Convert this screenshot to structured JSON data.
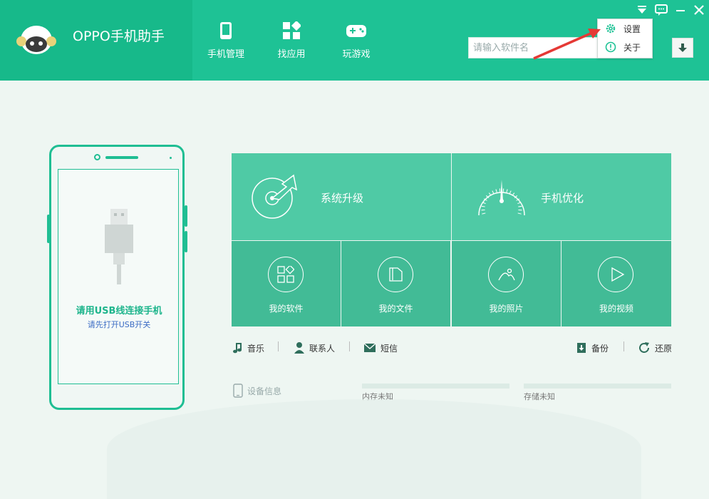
{
  "app": {
    "title": "OPPO手机助手"
  },
  "nav": [
    {
      "label": "手机管理",
      "icon": "phone-manage-icon"
    },
    {
      "label": "找应用",
      "icon": "apps-grid-icon"
    },
    {
      "label": "玩游戏",
      "icon": "gamepad-icon"
    }
  ],
  "search": {
    "placeholder": "请输入软件名"
  },
  "menu": {
    "items": [
      {
        "label": "设置",
        "icon": "gear-icon"
      },
      {
        "label": "关于",
        "icon": "info-icon"
      }
    ]
  },
  "connect": {
    "title": "请用USB线连接手机",
    "subtitle": "请先打开USB开关"
  },
  "tiles": {
    "big": [
      {
        "label": "系统升级",
        "icon": "upgrade-icon"
      },
      {
        "label": "手机优化",
        "icon": "speedometer-icon"
      }
    ],
    "small": [
      {
        "label": "我的软件",
        "icon": "software-icon"
      },
      {
        "label": "我的文件",
        "icon": "folder-icon"
      },
      {
        "label": "我的照片",
        "icon": "photo-icon"
      },
      {
        "label": "我的视频",
        "icon": "play-icon"
      }
    ]
  },
  "quick": {
    "music": "音乐",
    "contacts": "联系人",
    "sms": "短信",
    "backup": "备份",
    "restore": "还原"
  },
  "device": {
    "info_label": "设备信息",
    "memory_label": "内存未知",
    "storage_label": "存储未知"
  },
  "colors": {
    "accent": "#1ec295",
    "brand_dark": "#17b98a",
    "tile": "#4fcaa5",
    "tile_dark": "#42bb96",
    "arrow": "#e53935"
  }
}
